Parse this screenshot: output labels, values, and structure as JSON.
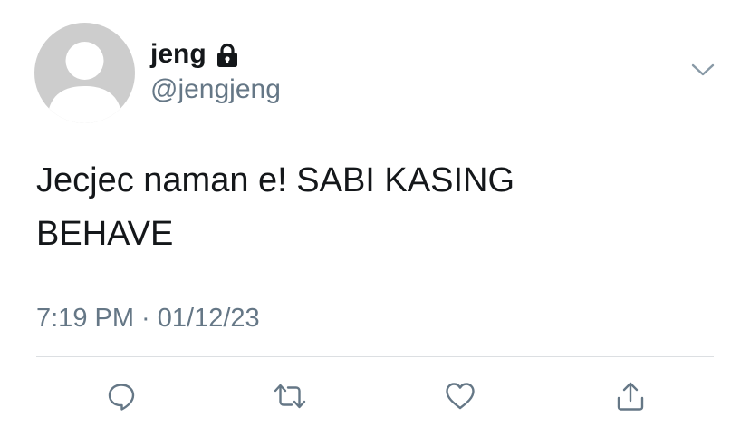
{
  "tweet": {
    "author": {
      "display_name": "jeng",
      "handle": "@jengjeng",
      "protected": true
    },
    "text": "Jecjec naman e! SABI KASING BEHAVE",
    "time": "7:19 PM",
    "separator": " · ",
    "date": "01/12/23"
  },
  "icons": {
    "lock": "lock-icon",
    "caret": "chevron-down-icon",
    "reply": "comment-icon",
    "retweet": "retweet-icon",
    "like": "heart-icon",
    "share": "share-icon"
  },
  "colors": {
    "text": "#14171a",
    "secondary_text": "#657786",
    "avatar_bg": "#cdcdcd",
    "avatar_fg": "#ffffff",
    "divider": "#dcdfe2",
    "icon": "#657786"
  }
}
